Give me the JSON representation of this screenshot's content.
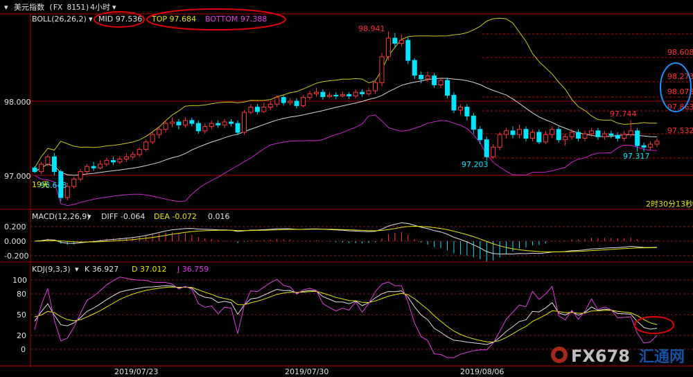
{
  "header": {
    "symbol": "美元指数",
    "code": "(FX 8151)",
    "period": "4小时",
    "period_arrow": "▾"
  },
  "boll": {
    "label": "BOLL(26,26,2)",
    "arrow": "▾",
    "mid": "MID 97.536",
    "top": "TOP 97.684",
    "bottom": "BOTTOM 97.388"
  },
  "macd": {
    "label": "MACD(12,26,9)",
    "arrow": "▾",
    "diff": "DIFF -0.064",
    "dea": "DEA -0.072",
    "macd": "0.016"
  },
  "kdj": {
    "label": "KDJ(9,3,3)",
    "arrow": "▾",
    "k": "K 36.927",
    "d": "D 37.012",
    "j": "J 36.759"
  },
  "price_axis": [
    "98.000",
    "97.000"
  ],
  "macd_axis": [
    "0.200",
    "0.000",
    "-0.200"
  ],
  "kdj_axis": [
    "100",
    "80",
    "50",
    "20",
    "0"
  ],
  "date_labels": [
    "2019/07/23",
    "2019/07/30",
    "2019/08/06"
  ],
  "annotations": {
    "high": "98.941",
    "low1": "96.648",
    "low2": "97.203",
    "peak2": "97.744",
    "low3": "97.317",
    "days": "19天",
    "countdown": "2时30分13秒"
  },
  "fib_levels": [
    "98.608",
    "98.273",
    "98.078",
    "97.863",
    "97.532"
  ],
  "watermark": {
    "brand": "FX678",
    "cn": "汇通网"
  },
  "colors": {
    "up": "#ff3b3b",
    "down": "#00e5ff",
    "mid": "#d8d8d8",
    "top": "#c8c820",
    "bottom": "#cc22cc",
    "grid": "#8b1a1a",
    "frame": "#b00000",
    "annotation_red": "#e00000",
    "annotation_blue": "#1e90ff"
  },
  "chart_data": [
    {
      "type": "candlestick",
      "title": "美元指数 4小时",
      "indicator": "BOLL(26,26,2)",
      "ylim": [
        96.55,
        99.05
      ],
      "x_labels": [
        "2019/07/23",
        "2019/07/30",
        "2019/08/06"
      ],
      "candles": [
        [
          97.1,
          97.05,
          97.12,
          97.03
        ],
        [
          97.05,
          97.15,
          97.18,
          97.02
        ],
        [
          97.15,
          97.25,
          97.28,
          97.12
        ],
        [
          97.25,
          97.05,
          97.3,
          97.0
        ],
        [
          97.05,
          96.7,
          97.08,
          96.65
        ],
        [
          96.7,
          96.85,
          96.9,
          96.66
        ],
        [
          96.85,
          96.95,
          96.98,
          96.82
        ],
        [
          96.95,
          97.05,
          97.08,
          96.92
        ],
        [
          97.05,
          97.12,
          97.15,
          97.02
        ],
        [
          97.12,
          97.1,
          97.18,
          97.06
        ],
        [
          97.1,
          97.15,
          97.2,
          97.08
        ],
        [
          97.15,
          97.2,
          97.24,
          97.12
        ],
        [
          97.2,
          97.18,
          97.25,
          97.14
        ],
        [
          97.18,
          97.22,
          97.26,
          97.15
        ],
        [
          97.22,
          97.25,
          97.3,
          97.18
        ],
        [
          97.25,
          97.28,
          97.32,
          97.22
        ],
        [
          97.28,
          97.35,
          97.38,
          97.25
        ],
        [
          97.35,
          97.45,
          97.48,
          97.32
        ],
        [
          97.45,
          97.55,
          97.6,
          97.42
        ],
        [
          97.55,
          97.62,
          97.66,
          97.5
        ],
        [
          97.62,
          97.7,
          97.74,
          97.58
        ],
        [
          97.7,
          97.72,
          97.78,
          97.65
        ],
        [
          97.72,
          97.68,
          97.76,
          97.62
        ],
        [
          97.68,
          97.74,
          97.78,
          97.64
        ],
        [
          97.74,
          97.7,
          97.78,
          97.66
        ],
        [
          97.7,
          97.6,
          97.74,
          97.56
        ],
        [
          97.6,
          97.66,
          97.7,
          97.56
        ],
        [
          97.66,
          97.7,
          97.74,
          97.62
        ],
        [
          97.7,
          97.68,
          97.74,
          97.64
        ],
        [
          97.68,
          97.72,
          97.76,
          97.64
        ],
        [
          97.72,
          97.7,
          97.76,
          97.66
        ],
        [
          97.7,
          97.58,
          97.74,
          97.54
        ],
        [
          97.58,
          97.85,
          97.88,
          97.55
        ],
        [
          97.85,
          97.92,
          97.96,
          97.82
        ],
        [
          97.92,
          97.86,
          97.96,
          97.82
        ],
        [
          97.86,
          97.92,
          97.98,
          97.84
        ],
        [
          97.92,
          97.96,
          98.0,
          97.88
        ],
        [
          97.96,
          98.05,
          98.08,
          97.92
        ],
        [
          98.05,
          97.98,
          98.08,
          97.94
        ],
        [
          97.98,
          98.0,
          98.04,
          97.94
        ],
        [
          98.0,
          97.94,
          98.04,
          97.9
        ],
        [
          97.94,
          98.05,
          98.08,
          97.92
        ],
        [
          98.05,
          98.1,
          98.14,
          98.02
        ],
        [
          98.1,
          98.12,
          98.18,
          98.06
        ],
        [
          98.12,
          98.06,
          98.16,
          98.02
        ],
        [
          98.06,
          98.08,
          98.12,
          98.04
        ],
        [
          98.08,
          98.07,
          98.12,
          98.03
        ],
        [
          98.07,
          98.09,
          98.13,
          98.05
        ],
        [
          98.09,
          98.07,
          98.12,
          98.03
        ],
        [
          98.07,
          98.12,
          98.16,
          98.04
        ],
        [
          98.12,
          98.1,
          98.16,
          98.06
        ],
        [
          98.1,
          98.14,
          98.18,
          98.07
        ],
        [
          98.14,
          98.25,
          98.28,
          98.1
        ],
        [
          98.25,
          98.6,
          98.65,
          98.2
        ],
        [
          98.6,
          98.85,
          98.94,
          98.55
        ],
        [
          98.85,
          98.78,
          98.92,
          98.72
        ],
        [
          98.78,
          98.82,
          98.9,
          98.74
        ],
        [
          98.82,
          98.55,
          98.86,
          98.5
        ],
        [
          98.55,
          98.35,
          98.58,
          98.3
        ],
        [
          98.35,
          98.3,
          98.4,
          98.24
        ],
        [
          98.3,
          98.34,
          98.4,
          98.26
        ],
        [
          98.34,
          98.22,
          98.38,
          98.18
        ],
        [
          98.22,
          98.28,
          98.32,
          98.18
        ],
        [
          98.28,
          98.08,
          98.32,
          98.04
        ],
        [
          98.08,
          97.88,
          98.12,
          97.84
        ],
        [
          97.88,
          97.92,
          97.96,
          97.82
        ],
        [
          97.92,
          97.8,
          97.96,
          97.74
        ],
        [
          97.8,
          97.62,
          97.84,
          97.56
        ],
        [
          97.62,
          97.48,
          97.66,
          97.42
        ],
        [
          97.48,
          97.25,
          97.52,
          97.2
        ],
        [
          97.25,
          97.38,
          97.42,
          97.22
        ],
        [
          97.38,
          97.55,
          97.58,
          97.34
        ],
        [
          97.55,
          97.6,
          97.64,
          97.5
        ],
        [
          97.6,
          97.55,
          97.66,
          97.5
        ],
        [
          97.55,
          97.62,
          97.68,
          97.5
        ],
        [
          97.62,
          97.5,
          97.66,
          97.46
        ],
        [
          97.5,
          97.58,
          97.62,
          97.46
        ],
        [
          97.58,
          97.45,
          97.62,
          97.42
        ],
        [
          97.45,
          97.55,
          97.6,
          97.42
        ],
        [
          97.55,
          97.62,
          97.66,
          97.5
        ],
        [
          97.62,
          97.48,
          97.66,
          97.44
        ],
        [
          97.48,
          97.52,
          97.56,
          97.4
        ],
        [
          97.52,
          97.58,
          97.62,
          97.48
        ],
        [
          97.58,
          97.5,
          97.62,
          97.46
        ],
        [
          97.5,
          97.56,
          97.6,
          97.46
        ],
        [
          97.56,
          97.6,
          97.64,
          97.52
        ],
        [
          97.6,
          97.52,
          97.64,
          97.48
        ],
        [
          97.52,
          97.56,
          97.6,
          97.48
        ],
        [
          97.56,
          97.54,
          97.6,
          97.5
        ],
        [
          97.54,
          97.5,
          97.58,
          97.46
        ],
        [
          97.5,
          97.55,
          97.6,
          97.46
        ],
        [
          97.55,
          97.6,
          97.74,
          97.52
        ],
        [
          97.6,
          97.4,
          97.64,
          97.32
        ],
        [
          97.4,
          97.38,
          97.44,
          97.32
        ],
        [
          97.38,
          97.42,
          97.46,
          97.34
        ],
        [
          97.42,
          97.46,
          97.5,
          97.38
        ]
      ]
    },
    {
      "type": "line",
      "title": "MACD(12,26,9)",
      "ylim": [
        -0.25,
        0.25
      ],
      "series": [
        {
          "name": "DIFF",
          "last": -0.064
        },
        {
          "name": "DEA",
          "last": -0.072
        },
        {
          "name": "MACD",
          "last": 0.016
        }
      ]
    },
    {
      "type": "line",
      "title": "KDJ(9,3,3)",
      "ylim": [
        -10,
        110
      ],
      "series": [
        {
          "name": "K",
          "last": 36.927
        },
        {
          "name": "D",
          "last": 37.012
        },
        {
          "name": "J",
          "last": 36.759
        }
      ]
    }
  ]
}
